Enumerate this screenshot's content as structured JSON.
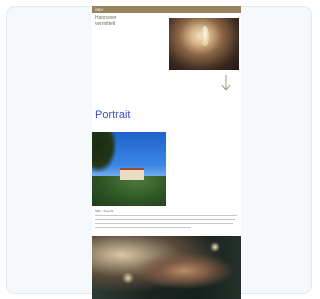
{
  "header": {
    "logo_text": "SBV",
    "subnav_text": "Hannover\nvermittelt"
  },
  "icons": {
    "scroll_indicator": "arrow-down-icon"
  },
  "main": {
    "section_title": "Portrait",
    "caption": "SBV · Ansicht"
  },
  "colors": {
    "topbar": "#9a8460",
    "title_accent": "#3b4fc4",
    "background_card": "#f6f9fc"
  }
}
